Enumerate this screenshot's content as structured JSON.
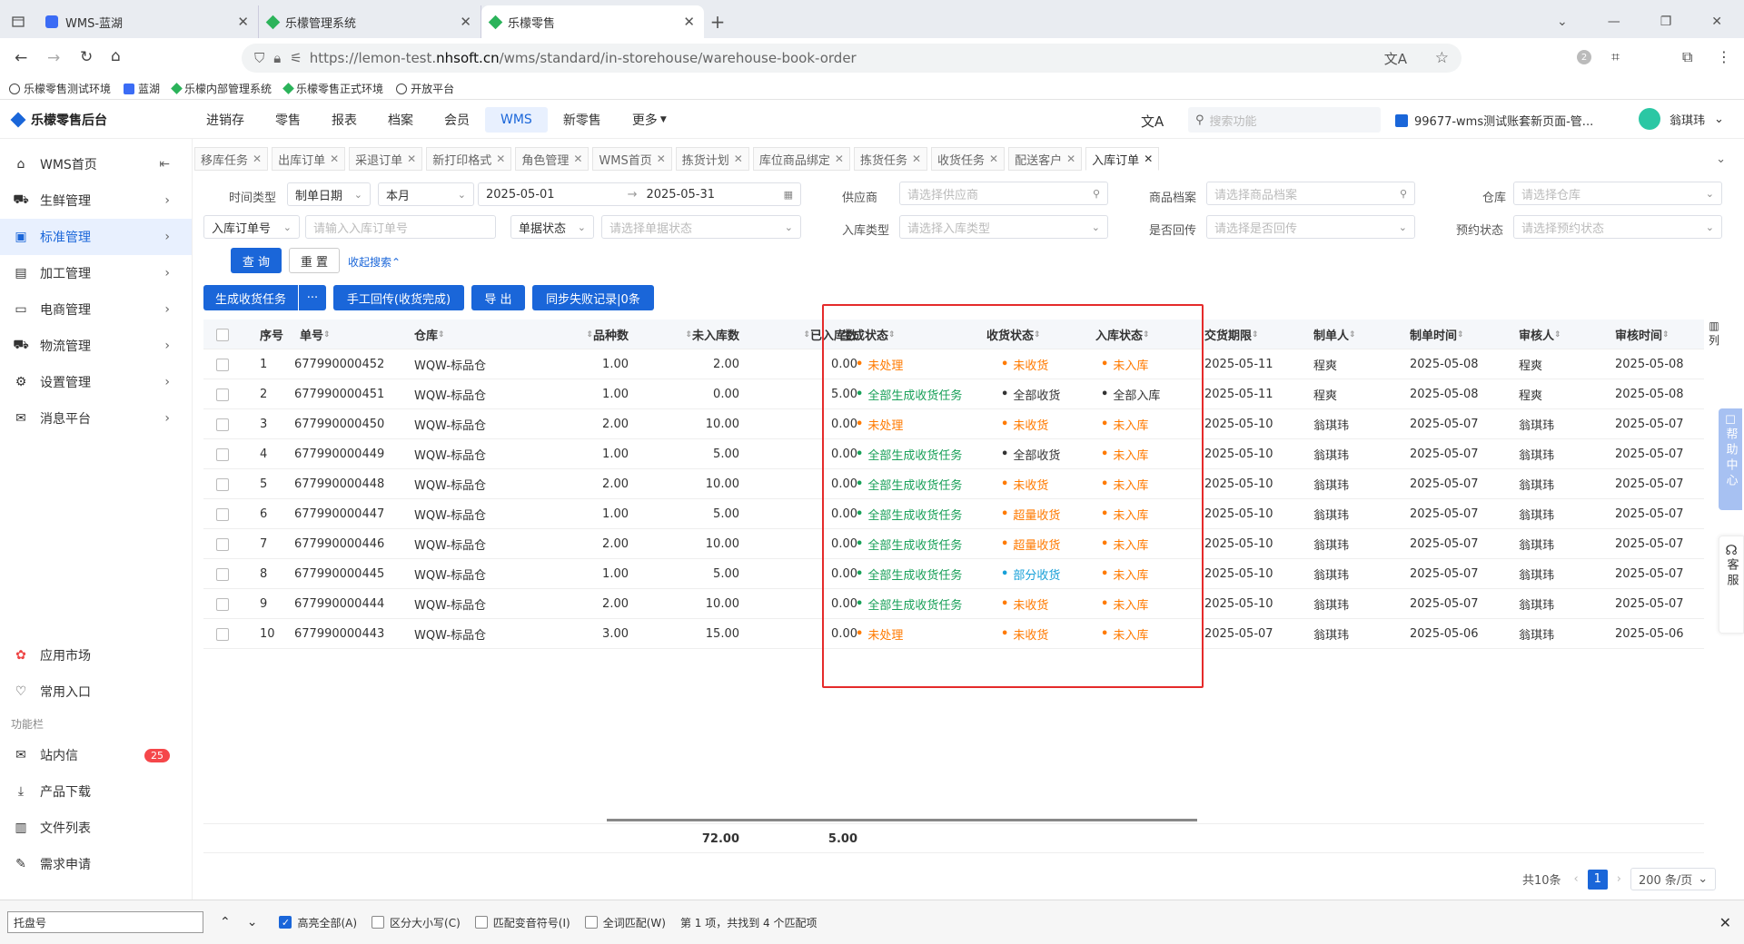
{
  "browser": {
    "tabs": [
      {
        "label": "WMS-蓝湖"
      },
      {
        "label": "乐檬管理系统"
      },
      {
        "label": "乐檬零售"
      }
    ],
    "url_prefix": "https://lemon-test.",
    "url_host": "nhsoft.cn",
    "url_path": "/wms/standard/in-storehouse/warehouse-book-order",
    "bookmarks": [
      {
        "label": "乐檬零售测试环境"
      },
      {
        "label": "蓝湖"
      },
      {
        "label": "乐檬内部管理系统"
      },
      {
        "label": "乐檬零售正式环境"
      },
      {
        "label": "开放平台"
      }
    ],
    "ext_badge": "2"
  },
  "app": {
    "logo": "乐檬零售后台",
    "nav": [
      {
        "label": "进销存"
      },
      {
        "label": "零售"
      },
      {
        "label": "报表"
      },
      {
        "label": "档案"
      },
      {
        "label": "会员"
      },
      {
        "label": "WMS"
      },
      {
        "label": "新零售"
      },
      {
        "label": "更多"
      }
    ],
    "search_placeholder": "搜索功能",
    "store": "99677-wms测试账套新页面-管...",
    "user": "翁琪玮"
  },
  "sidebar": {
    "items": [
      {
        "label": "WMS首页"
      },
      {
        "label": "生鲜管理"
      },
      {
        "label": "标准管理"
      },
      {
        "label": "加工管理"
      },
      {
        "label": "电商管理"
      },
      {
        "label": "物流管理"
      },
      {
        "label": "设置管理"
      },
      {
        "label": "消息平台"
      }
    ],
    "bottom": [
      {
        "label": "应用市场"
      },
      {
        "label": "常用入口"
      }
    ],
    "section": "功能栏",
    "func": [
      {
        "label": "站内信",
        "badge": "25"
      },
      {
        "label": "产品下载"
      },
      {
        "label": "文件列表"
      },
      {
        "label": "需求申请"
      }
    ]
  },
  "page_tabs": [
    {
      "label": "移库任务"
    },
    {
      "label": "出库订单"
    },
    {
      "label": "采退订单"
    },
    {
      "label": "新打印格式"
    },
    {
      "label": "角色管理"
    },
    {
      "label": "WMS首页"
    },
    {
      "label": "拣货计划"
    },
    {
      "label": "库位商品绑定"
    },
    {
      "label": "拣货任务"
    },
    {
      "label": "收货任务"
    },
    {
      "label": "配送客户"
    },
    {
      "label": "入库订单"
    }
  ],
  "filters": {
    "time_type_label": "时间类型",
    "time_type": "制单日期",
    "period": "本月",
    "date_from": "2025-05-01",
    "date_to": "2025-05-31",
    "supplier_label": "供应商",
    "supplier_ph": "请选择供应商",
    "goods_label": "商品档案",
    "goods_ph": "请选择商品档案",
    "warehouse_label": "仓库",
    "warehouse_ph": "请选择仓库",
    "order_field": "入库订单号",
    "order_ph": "请输入入库订单号",
    "doc_state_field": "单据状态",
    "doc_state_ph": "请选择单据状态",
    "in_type_label": "入库类型",
    "in_type_ph": "请选择入库类型",
    "return_label": "是否回传",
    "return_ph": "请选择是否回传",
    "appt_label": "预约状态",
    "appt_ph": "请选择预约状态",
    "query": "查 询",
    "reset": "重 置",
    "collapse": "收起搜索"
  },
  "actions": {
    "gen": "生成收货任务",
    "more": "···",
    "manual": "手工回传(收货完成)",
    "export": "导 出",
    "sync": "同步失败记录|0条"
  },
  "table": {
    "headers": [
      "序号",
      "单号",
      "仓库",
      "品种数",
      "未入库数",
      "已入库数",
      "生成状态",
      "收货状态",
      "入库状态",
      "交货期限",
      "制单人",
      "制单时间",
      "审核人",
      "审核时间"
    ],
    "rows": [
      {
        "no": "1",
        "order": "677990000452",
        "wh": "WQW-标品仓",
        "kinds": "1.00",
        "notin": "2.00",
        "in": "0.00",
        "gen": "未处理",
        "gen_c": "orange",
        "recv": "未收货",
        "recv_c": "orange",
        "stock": "未入库",
        "stock_c": "orange",
        "due": "2025-05-11",
        "maker": "程爽",
        "mtime": "2025-05-08",
        "auditor": "程爽",
        "atime": "2025-05-08"
      },
      {
        "no": "2",
        "order": "677990000451",
        "wh": "WQW-标品仓",
        "kinds": "1.00",
        "notin": "0.00",
        "in": "5.00",
        "gen": "全部生成收货任务",
        "gen_c": "green",
        "recv": "全部收货",
        "recv_c": "gray",
        "stock": "全部入库",
        "stock_c": "gray",
        "due": "2025-05-11",
        "maker": "程爽",
        "mtime": "2025-05-08",
        "auditor": "程爽",
        "atime": "2025-05-08"
      },
      {
        "no": "3",
        "order": "677990000450",
        "wh": "WQW-标品仓",
        "kinds": "2.00",
        "notin": "10.00",
        "in": "0.00",
        "gen": "未处理",
        "gen_c": "orange",
        "recv": "未收货",
        "recv_c": "orange",
        "stock": "未入库",
        "stock_c": "orange",
        "due": "2025-05-10",
        "maker": "翁琪玮",
        "mtime": "2025-05-07",
        "auditor": "翁琪玮",
        "atime": "2025-05-07"
      },
      {
        "no": "4",
        "order": "677990000449",
        "wh": "WQW-标品仓",
        "kinds": "1.00",
        "notin": "5.00",
        "in": "0.00",
        "gen": "全部生成收货任务",
        "gen_c": "green",
        "recv": "全部收货",
        "recv_c": "gray",
        "stock": "未入库",
        "stock_c": "orange",
        "due": "2025-05-10",
        "maker": "翁琪玮",
        "mtime": "2025-05-07",
        "auditor": "翁琪玮",
        "atime": "2025-05-07"
      },
      {
        "no": "5",
        "order": "677990000448",
        "wh": "WQW-标品仓",
        "kinds": "2.00",
        "notin": "10.00",
        "in": "0.00",
        "gen": "全部生成收货任务",
        "gen_c": "green",
        "recv": "未收货",
        "recv_c": "orange",
        "stock": "未入库",
        "stock_c": "orange",
        "due": "2025-05-10",
        "maker": "翁琪玮",
        "mtime": "2025-05-07",
        "auditor": "翁琪玮",
        "atime": "2025-05-07"
      },
      {
        "no": "6",
        "order": "677990000447",
        "wh": "WQW-标品仓",
        "kinds": "1.00",
        "notin": "5.00",
        "in": "0.00",
        "gen": "全部生成收货任务",
        "gen_c": "green",
        "recv": "超量收货",
        "recv_c": "orange",
        "stock": "未入库",
        "stock_c": "orange",
        "due": "2025-05-10",
        "maker": "翁琪玮",
        "mtime": "2025-05-07",
        "auditor": "翁琪玮",
        "atime": "2025-05-07"
      },
      {
        "no": "7",
        "order": "677990000446",
        "wh": "WQW-标品仓",
        "kinds": "2.00",
        "notin": "10.00",
        "in": "0.00",
        "gen": "全部生成收货任务",
        "gen_c": "green",
        "recv": "超量收货",
        "recv_c": "orange",
        "stock": "未入库",
        "stock_c": "orange",
        "due": "2025-05-10",
        "maker": "翁琪玮",
        "mtime": "2025-05-07",
        "auditor": "翁琪玮",
        "atime": "2025-05-07"
      },
      {
        "no": "8",
        "order": "677990000445",
        "wh": "WQW-标品仓",
        "kinds": "1.00",
        "notin": "5.00",
        "in": "0.00",
        "gen": "全部生成收货任务",
        "gen_c": "green",
        "recv": "部分收货",
        "recv_c": "blue",
        "stock": "未入库",
        "stock_c": "orange",
        "due": "2025-05-10",
        "maker": "翁琪玮",
        "mtime": "2025-05-07",
        "auditor": "翁琪玮",
        "atime": "2025-05-07"
      },
      {
        "no": "9",
        "order": "677990000444",
        "wh": "WQW-标品仓",
        "kinds": "2.00",
        "notin": "10.00",
        "in": "0.00",
        "gen": "全部生成收货任务",
        "gen_c": "green",
        "recv": "未收货",
        "recv_c": "orange",
        "stock": "未入库",
        "stock_c": "orange",
        "due": "2025-05-10",
        "maker": "翁琪玮",
        "mtime": "2025-05-07",
        "auditor": "翁琪玮",
        "atime": "2025-05-07"
      },
      {
        "no": "10",
        "order": "677990000443",
        "wh": "WQW-标品仓",
        "kinds": "3.00",
        "notin": "15.00",
        "in": "0.00",
        "gen": "未处理",
        "gen_c": "orange",
        "recv": "未收货",
        "recv_c": "orange",
        "stock": "未入库",
        "stock_c": "orange",
        "due": "2025-05-07",
        "maker": "翁琪玮",
        "mtime": "2025-05-06",
        "auditor": "翁琪玮",
        "atime": "2025-05-06"
      }
    ],
    "total_notin": "72.00",
    "total_in": "5.00",
    "col_setting": "列"
  },
  "pager": {
    "total": "共10条",
    "page": "1",
    "size": "200 条/页"
  },
  "findbar": {
    "query": "托盘号",
    "opts": [
      {
        "label": "高亮全部(A)",
        "on": true
      },
      {
        "label": "区分大小写(C)",
        "on": false
      },
      {
        "label": "匹配变音符号(I)",
        "on": false
      },
      {
        "label": "全词匹配(W)",
        "on": false
      }
    ],
    "status": "第 1 项，共找到 4 个匹配项"
  },
  "float": {
    "help": "帮助中心",
    "kefu": "客服"
  },
  "colors": {
    "primary": "#1a66d9",
    "orange": "#ff7a00",
    "green": "#18a058",
    "blue": "#18a0d8",
    "highlight": "#e52b2b"
  }
}
